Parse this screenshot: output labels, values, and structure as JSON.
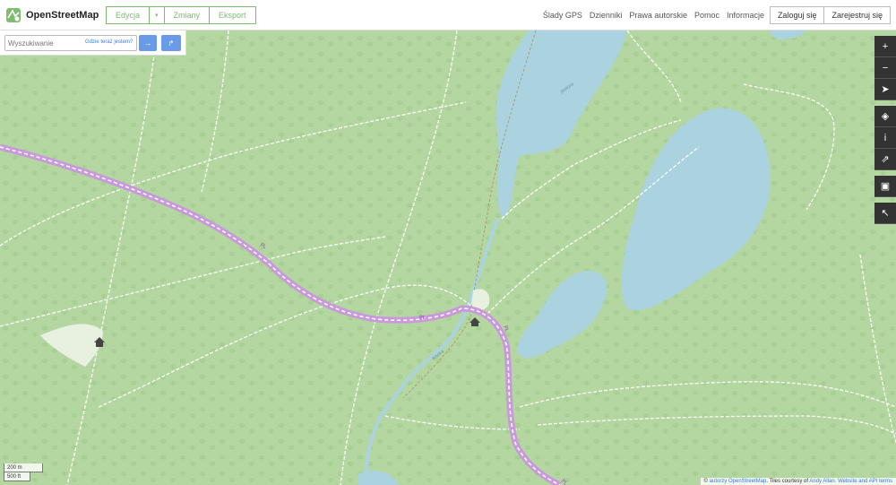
{
  "header": {
    "brand": "OpenStreetMap",
    "edit_label": "Edycja",
    "edit_caret": "▾",
    "changes_label": "Zmiany",
    "export_label": "Eksport",
    "nav": [
      "Ślady GPS",
      "Dzienniki",
      "Prawa autorskie",
      "Pomoc",
      "Informacje"
    ],
    "login_label": "Zaloguj się",
    "register_label": "Zarejestruj się"
  },
  "search": {
    "placeholder": "Wyszukiwanie",
    "where_am_i": "Gdzie teraz jestem?",
    "go_icon": "→",
    "directions_icon": "↱"
  },
  "controls": {
    "zoom_in": "+",
    "zoom_out": "−",
    "locate": "➤",
    "layers": "◈",
    "info": "i",
    "share": "⇗",
    "note": "▣",
    "query": "↖"
  },
  "map": {
    "route_labels": [
      "PL",
      "PL",
      "PL",
      "PL"
    ],
    "water_labels": [
      "Jezioro",
      "Rzeka"
    ]
  },
  "scale": {
    "metric": "200 m",
    "imperial": "500 ft"
  },
  "attribution": {
    "prefix": "© ",
    "osm_link": "autorzy OpenStreetMap",
    "tiles": ". Tiles courtesy of ",
    "tiles_link": "Andy Allan",
    "api": ". Website and API terms"
  },
  "colors": {
    "forest": "#b4d6a0",
    "water": "#aad3df",
    "route": "#c99ad9",
    "accent": "#7ebc6f"
  }
}
